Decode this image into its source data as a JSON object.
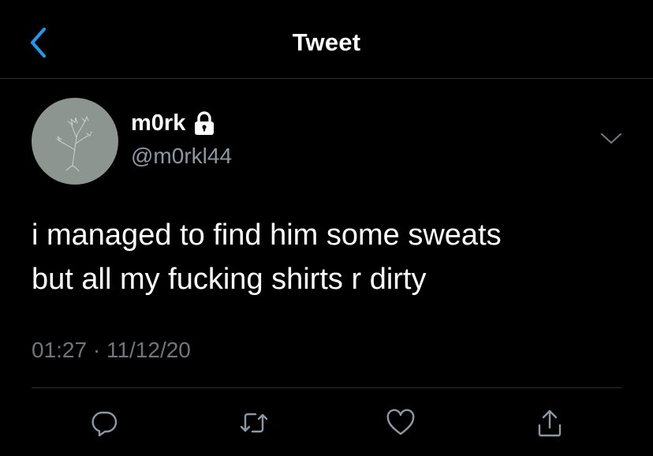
{
  "header": {
    "title": "Tweet"
  },
  "tweet": {
    "display_name": "m0rk",
    "handle": "@m0rkl44",
    "text_lines": [
      "i managed to find him some sweats",
      "but all my fucking shirts r dirty"
    ],
    "timestamp": "01:27 · 11/12/20"
  },
  "colors": {
    "background": "#000000",
    "accent": "#1d9bf0",
    "secondary_text": "#8b98a5",
    "divider": "#2f3336",
    "avatar_bg": "#8c9590"
  },
  "icons": {
    "back": "chevron-left-icon",
    "lock": "lock-icon",
    "more": "chevron-down-icon",
    "reply": "reply-icon",
    "retweet": "retweet-icon",
    "like": "heart-icon",
    "share": "share-icon"
  }
}
